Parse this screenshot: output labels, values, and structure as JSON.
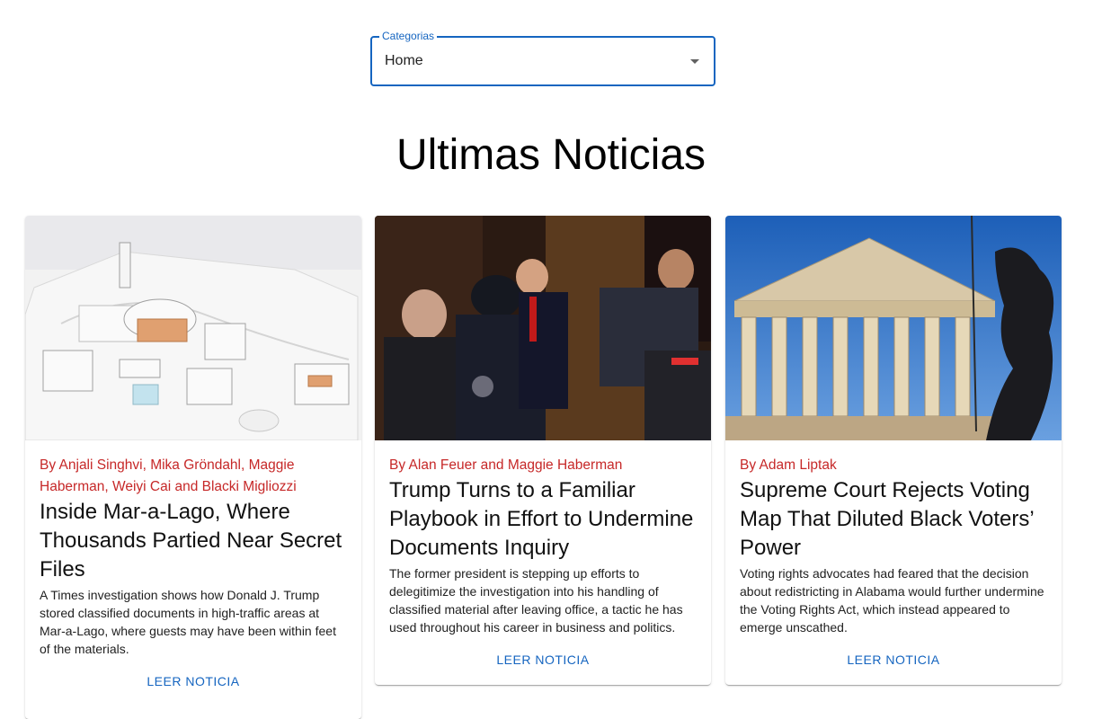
{
  "filter": {
    "label": "Categorias",
    "selected": "Home"
  },
  "page_title": "Ultimas Noticias",
  "articles": [
    {
      "byline": "By Anjali Singhvi, Mika Gröndahl, Maggie Haberman, Weiyi Cai and Blacki Migliozzi",
      "title": "Inside Mar-a-Lago, Where Thousands Partied Near Secret Files",
      "abstract": "A Times investigation shows how Donald J. Trump stored classified documents in high-traffic areas at Mar-a-Lago, where guests may have been within feet of the materials.",
      "button": "LEER NOTICIA"
    },
    {
      "byline": "By Alan Feuer and Maggie Haberman",
      "title": "Trump Turns to a Familiar Playbook in Effort to Undermine Documents Inquiry",
      "abstract": "The former president is stepping up efforts to delegitimize the investigation into his handling of classified material after leaving office, a tactic he has used throughout his career in business and politics.",
      "button": "LEER NOTICIA"
    },
    {
      "byline": "By Adam Liptak",
      "title": "Supreme Court Rejects Voting Map That Diluted Black Voters’ Power",
      "abstract": "Voting rights advocates had feared that the decision about redistricting in Alabama would further undermine the Voting Rights Act, which instead appeared to emerge unscathed.",
      "button": "LEER NOTICIA"
    }
  ],
  "colors": {
    "accent": "#1565c0",
    "byline": "#c62828"
  }
}
